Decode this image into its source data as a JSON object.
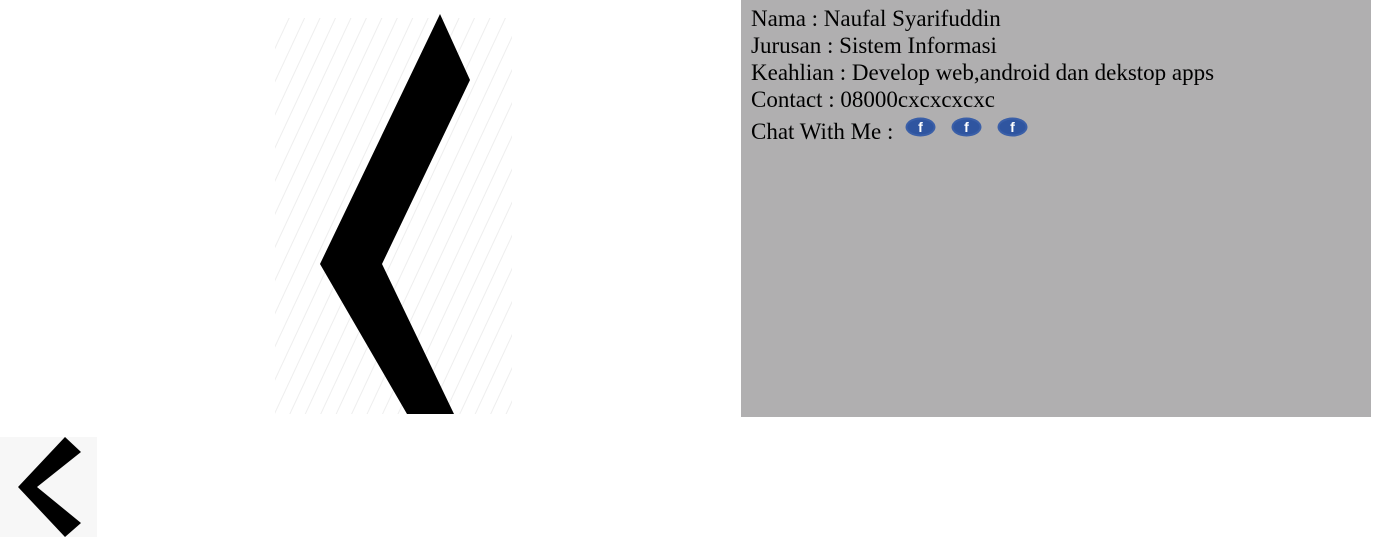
{
  "profile": {
    "nama": "Nama : Naufal Syarifuddin",
    "jurusan": "Jurusan : Sistem Informasi",
    "keahlian": "Keahlian : Develop web,android dan dekstop apps",
    "contact": "Contact : 08000cxcxcxcxc",
    "chat_label": "Chat With Me :"
  },
  "social_icons": [
    {
      "icon": "facebook-icon",
      "glyph": "f"
    },
    {
      "icon": "facebook-icon",
      "glyph": "f"
    },
    {
      "icon": "facebook-icon",
      "glyph": "f"
    }
  ],
  "colors": {
    "panel_bg": "#b0afb0",
    "facebook_blue": "#3a5fa8",
    "arrow": "#000000"
  }
}
